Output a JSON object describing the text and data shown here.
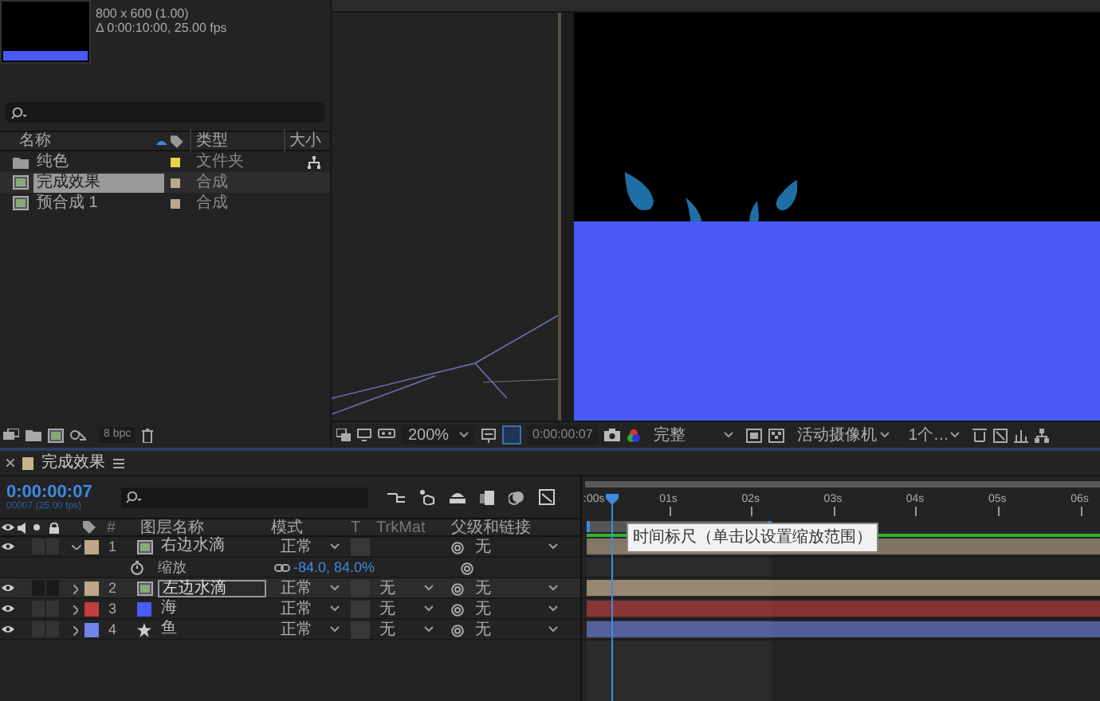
{
  "project": {
    "info": [
      "800 x 600 (1.00)",
      "Δ 0:00:10:00, 25.00 fps"
    ],
    "columns": [
      "名称",
      "类型",
      "大小"
    ],
    "items": [
      {
        "name": "纯色",
        "kind": "folder",
        "type": "文件夹",
        "color": "#e8d44a",
        "selected": false
      },
      {
        "name": "完成效果",
        "kind": "comp",
        "type": "合成",
        "color": "#b9a98a",
        "selected": true
      },
      {
        "name": "预合成 1",
        "kind": "comp",
        "type": "合成",
        "color": "#b9a98a",
        "selected": false
      }
    ],
    "bit_depth": "8 bpc"
  },
  "viewer": {
    "zoom": "200%",
    "timecode": "0:00:00:07",
    "resolution": "完整",
    "camera": "活动摄像机",
    "views": "1个…"
  },
  "timeline": {
    "title": "完成效果",
    "timecode": "0:00:00:07",
    "frame_info": "00007 (25.00 fps)",
    "columns": [
      "#",
      "图层名称",
      "模式",
      "T",
      "TrkMat",
      "父级和链接"
    ],
    "layers": [
      {
        "number": "1",
        "name": "右边水滴",
        "kind": "comp",
        "color": "#bda88a",
        "mode": "正常",
        "parent": "无",
        "expanded": true,
        "selected": false,
        "properties": [
          {
            "name": "缩放",
            "value": "-84.0, 84.0%"
          }
        ]
      },
      {
        "number": "2",
        "name": "左边水滴",
        "kind": "comp",
        "color": "#bda88a",
        "mode": "正常",
        "trkmat": "无",
        "parent": "无",
        "expanded": false,
        "selected": true
      },
      {
        "number": "3",
        "name": "海",
        "kind": "solid",
        "color": "#c43c3c",
        "mode": "正常",
        "trkmat": "无",
        "parent": "无",
        "expanded": false,
        "selected": false
      },
      {
        "number": "4",
        "name": "鱼",
        "kind": "shape",
        "color": "#6f84e8",
        "mode": "正常",
        "trkmat": "无",
        "parent": "无",
        "expanded": false,
        "selected": false
      }
    ],
    "ruler": [
      ":00s",
      "01s",
      "02s",
      "03s",
      "04s",
      "05s",
      "06s"
    ],
    "tooltip": "时间标尺（单击以设置缩放范围）"
  }
}
